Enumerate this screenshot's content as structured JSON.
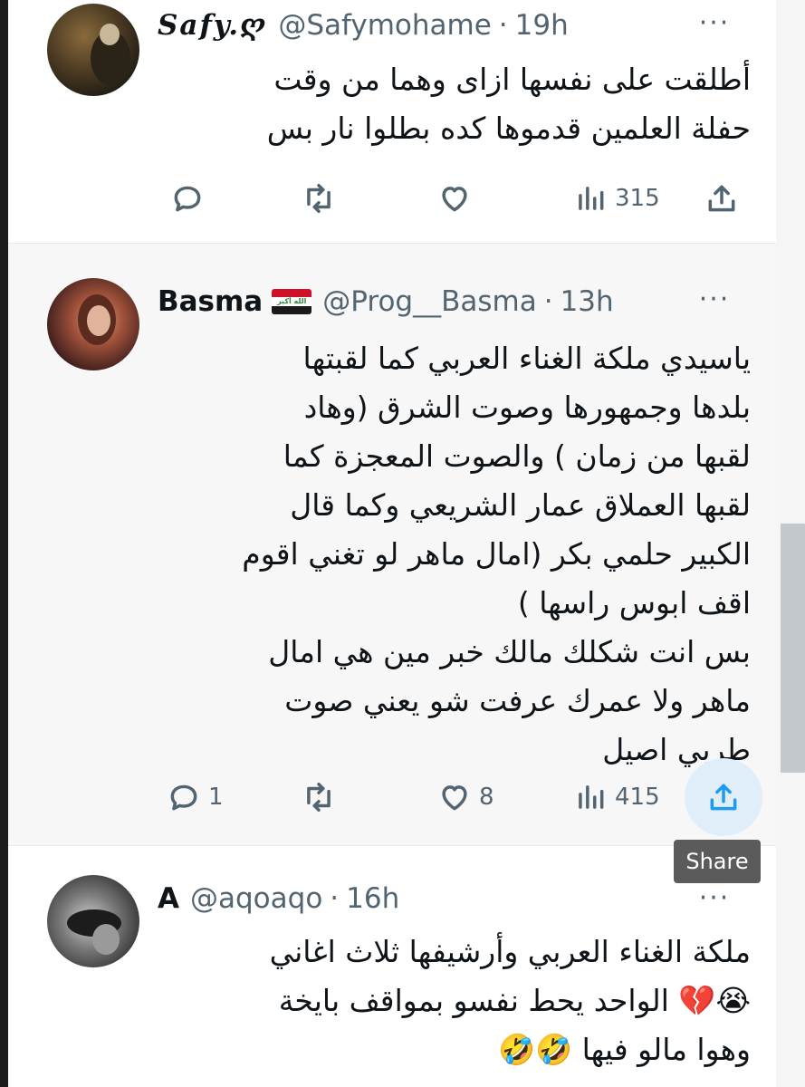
{
  "tweets": [
    {
      "name": "Safy.ღ",
      "handle": "@Safymohame",
      "separator": "·",
      "time": "19h",
      "more": "···",
      "text": "أطلقت على نفسها ازاى وهما من وقت\nحفلة العلمين قدموها كده بطلوا نار بس",
      "replies": "",
      "retweets": "",
      "likes": "",
      "views": "315"
    },
    {
      "name": "Basma",
      "flag": "iraq-flag-icon",
      "flag_text": "الله أكبر",
      "handle": "@Prog__Basma",
      "separator": "·",
      "time": "13h",
      "more": "···",
      "text": "ياسيدي ملكة الغناء العربي كما لقبتها\nبلدها وجمهورها  وصوت الشرق (وهاد\nلقبها من زمان ) والصوت المعجزة كما\nلقبها العملاق عمار الشريعي وكما قال\nالكبير حلمي بكر (امال ماهر لو تغني اقوم\nاقف ابوس راسها )\nبس انت شكلك مالك خبر مين هي امال\nماهر ولا عمرك عرفت شو يعني صوت\nطربي اصيل",
      "replies": "1",
      "retweets": "",
      "likes": "8",
      "views": "415"
    },
    {
      "name": "A",
      "handle": "@aqoaqo",
      "separator": "·",
      "time": "16h",
      "more": "···",
      "text": "ملكة الغناء العربي وأرشيفها ثلاث اغاني\n😭💔 الواحد يحط نفسو بمواقف بايخة\nوهوا مالو فيها 🤣🤣",
      "replies": "",
      "retweets": "",
      "likes": "",
      "views": ""
    }
  ],
  "tooltip": {
    "label": "Share"
  },
  "colors": {
    "text": "#0f1419",
    "secondary": "#536471",
    "hover_bg": "#f7f7f7",
    "share_highlight": "#dfeef8",
    "tooltip_bg": "#5b5b5b"
  }
}
